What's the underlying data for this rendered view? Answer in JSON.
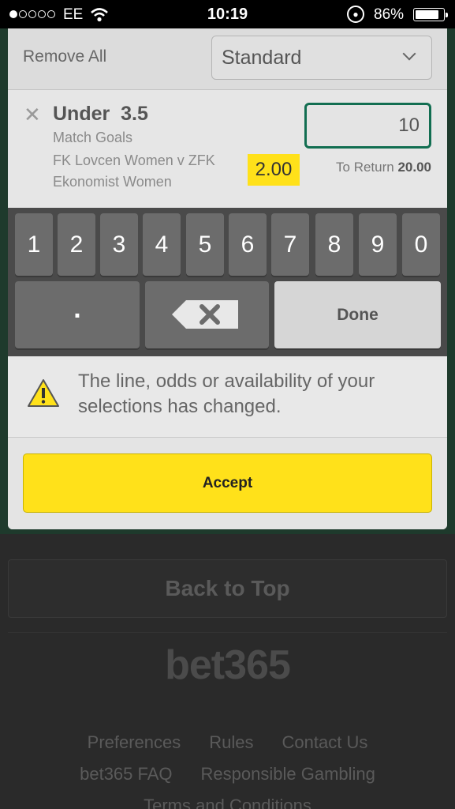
{
  "status_bar": {
    "carrier": "EE",
    "time": "10:19",
    "battery_percent": "86%",
    "battery_level": 0.86,
    "signal_bars": 1
  },
  "betslip": {
    "remove_all_label": "Remove All",
    "bet_type": "Standard",
    "selection": {
      "name": "Under  3.5",
      "market": "Match Goals",
      "event": "FK Lovcen Women v ZFK Ekonomist Women",
      "odds": "2.00",
      "stake": "10",
      "to_return_label": "To Return",
      "to_return_value": "20.00"
    },
    "keypad": {
      "keys": [
        "1",
        "2",
        "3",
        "4",
        "5",
        "6",
        "7",
        "8",
        "9",
        "0"
      ],
      "decimal": ".",
      "done": "Done"
    },
    "message": "The line, odds or availability of your selections has changed.",
    "accept_label": "Accept"
  },
  "page": {
    "back_to_top": "Back to Top",
    "logo": "bet365",
    "footer_links_row1": [
      "Preferences",
      "Rules",
      "Contact Us"
    ],
    "footer_links_row2": [
      "bet365 FAQ",
      "Responsible Gambling"
    ],
    "footer_links_row3": [
      "Terms and Conditions"
    ]
  },
  "colors": {
    "accent_yellow": "#ffe11a",
    "input_border_green": "#126e51",
    "keyboard_bg": "#4a4a4a"
  }
}
